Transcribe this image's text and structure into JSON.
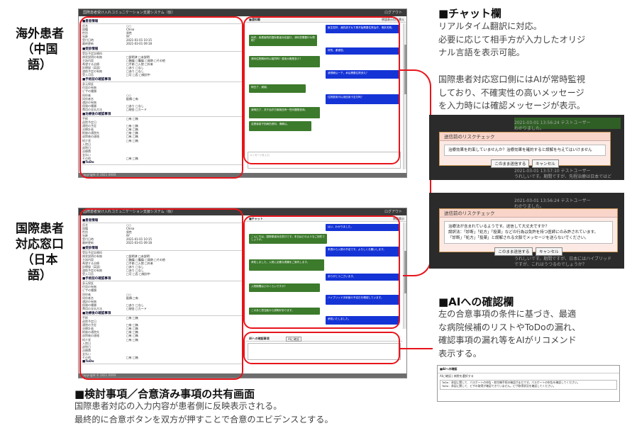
{
  "labels": {
    "foreign_patient": [
      "海外患者",
      "（中国語）"
    ],
    "intl_desk": [
      "国際患者",
      "対応窓口",
      "（日本語）"
    ]
  },
  "top_app": {
    "title": "国際患者受け入れコミュニケーション支援システム（仮）",
    "title_right": "ログアウト",
    "chat_head_left": "■通知欄",
    "chat_head_right": "原語表示切り替え",
    "footer": "Copyright © 2021 XXXX",
    "input_placeholder": "メッセージを入力",
    "bubbles": [
      "医生您好，我的孩子从下周开始需要住院治疗，请多关照。",
      "你好，我是医院的国际患者对应窗口，请问您需要什么帮助？",
      "好的，谢谢您。",
      "请问住院期间可以陪同吗？费用大概是多少？",
      "我想确认一下，术后需要住院多久？",
      "明白了，谢谢。",
      "住院费用可以用信用卡支付吗？",
      "我明白了，关于治疗方案我还有一些问题想咨询。",
      "这是我孩子的病历资料，请确认。"
    ]
  },
  "bottom_app": {
    "title": "国際患者受け入れコミュニケーション支援システム（仮）",
    "title_right": "ログアウト",
    "chat_head_left": "■チャット",
    "chat_head_right": "原語表示",
    "footer": "Copyright © 2021 XXXX",
    "bubbles": [
      "はい、わかりました。",
      "こんにちは、国際患者対応窓口です。本日はどのようなご用件でしょうか。",
      "来週から入院の予定です。よろしくお願いします。",
      "承知しました。入院に必要な書類をご案内します。",
      "ありがとうございます。",
      "入院期間はどのくらいですか？",
      "ハイブリッド手術室の予定日を確認しています。",
      "このあと担当医から説明があります。",
      "承知いたしました。"
    ],
    "ai_head": "AIへの確認事項",
    "ai_button": "AIに確認",
    "ai_text": ""
  },
  "form": {
    "sections": [
      {
        "title": "■患者情報",
        "rows": [
          [
            "氏名",
            "○○"
          ],
          [
            "国籍",
            "China"
          ],
          [
            "性別",
            "男性"
          ],
          [
            "年齢",
            "9Y"
          ],
          [
            "受付日時",
            "2021-01-01 10:15"
          ],
          [
            "最終更新",
            "2021-03-01 09:18"
          ]
        ]
      },
      {
        "title": "■受診情報",
        "rows": [
          [
            "受診予定診療科",
            ""
          ],
          [
            "病状説明の有無",
            "□説明済 □未説明"
          ],
          [
            "主訴内容",
            "□胸痛 □腹痛 □発熱 □その他"
          ],
          [
            "希望する治療",
            "□手術 □入院 □外来"
          ],
          [
            "診療録（英語）",
            "□あり □なし"
          ],
          [
            "渡航予定の有無",
            "□あり □なし"
          ],
          [
            "受入可否",
            "□可 □否 □検討中"
          ]
        ]
      },
      {
        "title": "■手術前の確認事項",
        "rows": [
          [
            "身元保証",
            ""
          ],
          [
            "住居の有無",
            ""
          ],
          [
            "ビザの種類",
            ""
          ],
          [
            "同伴者",
            "○○"
          ],
          [
            "同伴者名",
            "配偶 □有"
          ],
          [
            "通訳の有無",
            ""
          ],
          [
            "保険の種類",
            "□あり □なし"
          ],
          [
            "費用の支払方法",
            "□現金 □カード"
          ]
        ]
      },
      {
        "title": "■治療後の確認事項",
        "rows": [
          [
            "手術",
            "□有 □無"
          ],
          [
            "退院予定日",
            ""
          ],
          [
            "通院の予定",
            "□有 □無"
          ],
          [
            "治療計画",
            "□有 □無"
          ],
          [
            "術後の通院先",
            "□有 □無"
          ],
          [
            "退院後の連絡",
            "□有 □無"
          ],
          [
            "紹介状",
            "□有 □無"
          ],
          [
            "入院日",
            ""
          ],
          [
            "退院日",
            ""
          ],
          [
            "治療費",
            ""
          ],
          [
            "支払い",
            ""
          ],
          [
            "その他",
            "□有 □無"
          ]
        ]
      },
      {
        "title": "■ToDo",
        "rows": []
      }
    ]
  },
  "annotations": {
    "chat": {
      "title": "■チャット欄",
      "lines": [
        "リアルタイム翻訳に対応。",
        "必要に応じて相手方が入力したオリジ",
        "ナル言語を表示可能。"
      ]
    },
    "monitor": [
      "国際患者対応窓口側にはAIが常時監視",
      "しており、不確実性の高いメッセージ",
      "を入力時には確認メッセージが表示。"
    ],
    "ai": {
      "title": "■AIへの確認欄",
      "lines": [
        "左の合意事項の条件に基づき、最適",
        "な病院候補のリストやToDoの漏れ、",
        "確認事項の漏れ等をAIがリコメンド",
        "表示する。"
      ]
    },
    "shared": {
      "title": "■検討事項／合意済み事項の共有画面",
      "lines": [
        "国際患者対応の入力内容が患者側に反映表示される。",
        "最終的に合意ボタンを双方が押すことで合意のエビデンスとする。"
      ]
    }
  },
  "dialog1": {
    "title": "送信前のリスクチェック",
    "message": "治療効果を約束していませんか？治療効果を確約すると誤解を与えてはいけません",
    "ok": "このまま送信する",
    "cancel": "キャンセル",
    "bg_lines": [
      "2021-03-01 13:56:24 テストユーザー",
      "わかりました。",
      "2021-03-01 13:57:10 テストユーザー",
      "うれしいです。期間ですが、先程治療は日本ではど"
    ]
  },
  "dialog2": {
    "title": "送信前のリスクチェック",
    "message_lines": [
      "治療法が含まれているようです。送信して大丈夫ですか？",
      "誤訳法：「診断」「処方」「投薬」などの行為は免許を持つ医師にのみ許されています。",
      "「診断」「処方」「投薬」と誤解される文脈でメッセージを送らないでください。"
    ],
    "ok": "このまま送信する",
    "cancel": "キャンセル",
    "bg_lines": [
      "2021-03-01 13:56:24 テストユーザー",
      "わかりました。",
      "うれしいです。期間ですが、日本にはハイブリッド",
      "ですが、これはうつるのでしょうか？"
    ]
  },
  "mini_ai": {
    "title": "■AIへの確認",
    "row": "AIに確認 | 病院を選択する",
    "lines": [
      "ToDo：承認に関して、パスポートの申告・航空機手続の確認がまだです。パスポートの申告を確認してください。",
      "ToDo：承認に関して、ビザの取得が確認できていません。ビザ取得状況を確認してください。"
    ]
  },
  "colors": {
    "accent_red": "#e8141b",
    "bubble_green": "#3c7a2c",
    "bubble_blue": "#1534d6"
  }
}
